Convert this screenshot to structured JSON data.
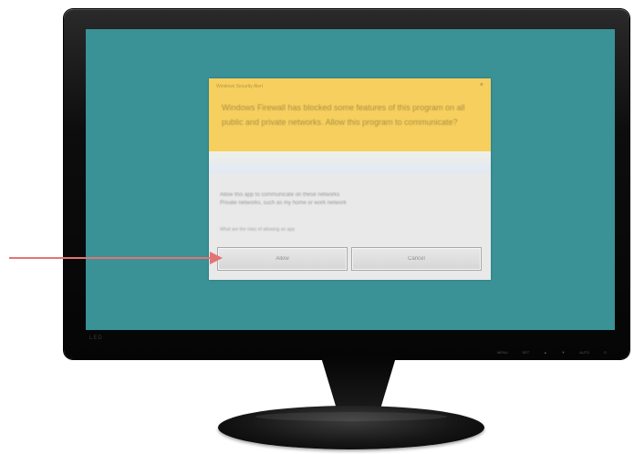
{
  "monitor": {
    "brand": "LED",
    "controls": [
      "MENU",
      "SET",
      "▲",
      "▼",
      "AUTO",
      "O"
    ]
  },
  "dialog": {
    "title": "Windows Security Alert",
    "close_label": "×",
    "warning_text": "Windows Firewall has blocked some features of this program on all public and private networks. Allow this program to communicate?",
    "info_lines": [
      "Allow this app to communicate on these networks",
      "Private networks, such as my home or work network"
    ],
    "hint_text": "What are the risks of allowing an app",
    "buttons": {
      "allow": "Allow",
      "cancel": "Cancel"
    }
  },
  "annotation": {
    "arrow_color": "#e47373",
    "points_to": "allow-button"
  },
  "colors": {
    "screen": "#3a9196",
    "warning_header": "#f6cf5e",
    "dialog_body": "#e9e9e9",
    "bezel": "#0d0d0d"
  }
}
